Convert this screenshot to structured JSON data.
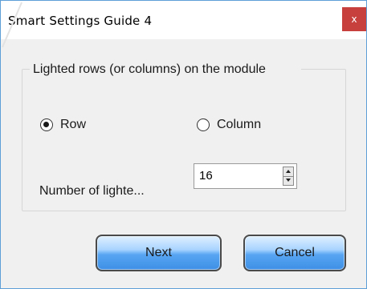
{
  "window": {
    "title": "Smart Settings Guide 4",
    "close_label": "x"
  },
  "group": {
    "legend": "Lighted rows (or columns) on the module",
    "options": [
      {
        "label": "Row",
        "selected": true
      },
      {
        "label": "Column",
        "selected": false
      }
    ]
  },
  "count": {
    "label": "Number of lighte...",
    "value": "16"
  },
  "buttons": {
    "next": "Next",
    "cancel": "Cancel"
  },
  "colors": {
    "close_button": "#c7403e",
    "window_border": "#5f9fd8",
    "button_blue": "#57a5f2",
    "background": "#f0f0f0"
  },
  "icons": {
    "close": "close-icon",
    "spin_up": "chevron-up-icon",
    "spin_down": "chevron-down-icon"
  }
}
